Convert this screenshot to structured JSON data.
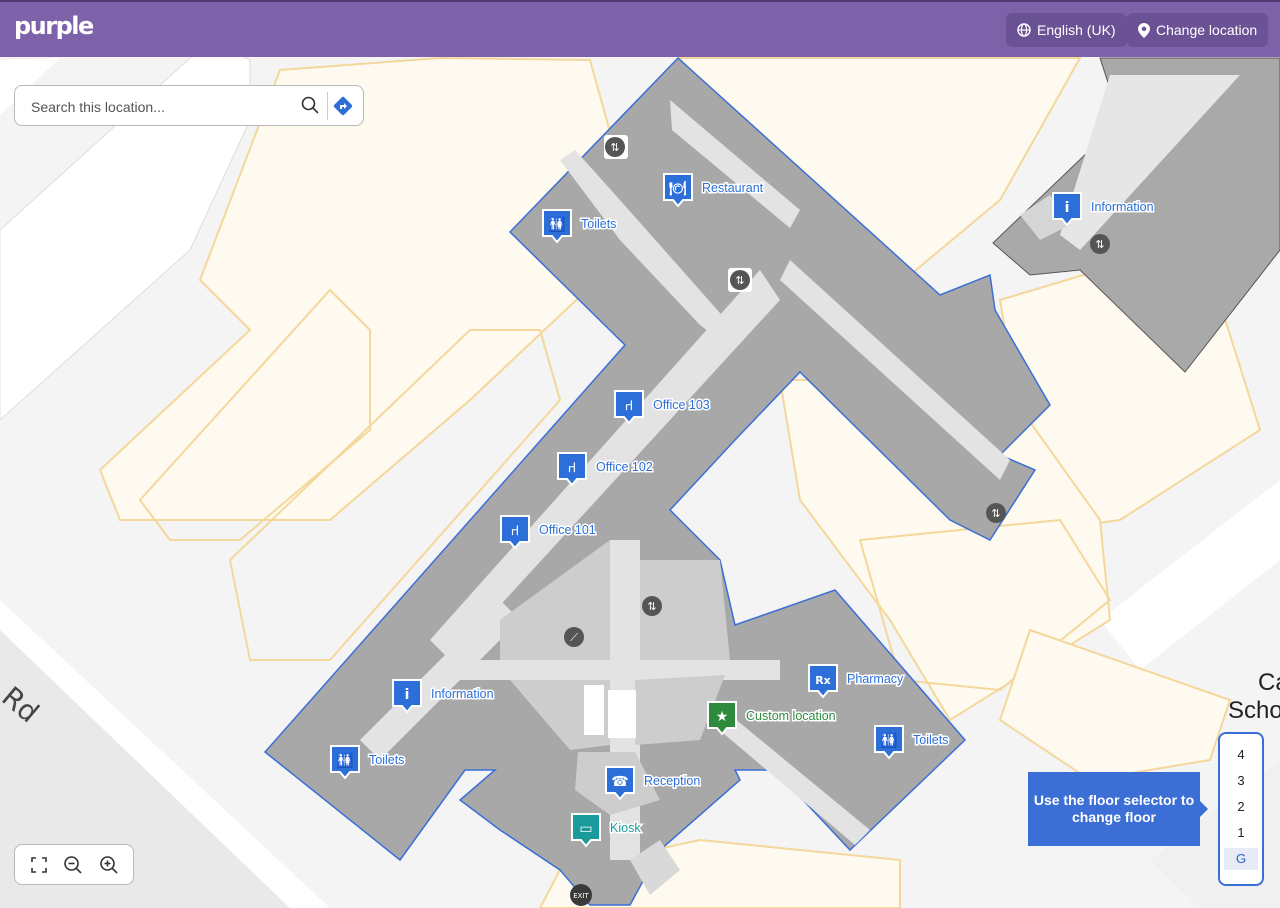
{
  "header": {
    "brand": "purple",
    "language_label": "English (UK)",
    "change_location_label": "Change location",
    "color": "#7d62a9"
  },
  "search": {
    "placeholder": "Search this location...",
    "search_icon": "search-icon",
    "directions_icon": "directions-icon"
  },
  "map": {
    "pois": [
      {
        "label": "Restaurant",
        "icon": "restaurant-icon",
        "color": "#2c6fd8"
      },
      {
        "label": "Toilets",
        "icon": "toilets-icon",
        "color": "#2c6fd8"
      },
      {
        "label": "Information",
        "icon": "information-icon",
        "color": "#2c6fd8"
      },
      {
        "label": "Office 103",
        "icon": "office-chair-icon",
        "color": "#2c6fd8"
      },
      {
        "label": "Office 102",
        "icon": "office-chair-icon",
        "color": "#2c6fd8"
      },
      {
        "label": "Office 101",
        "icon": "office-chair-icon",
        "color": "#2c6fd8"
      },
      {
        "label": "Information",
        "icon": "information-icon",
        "color": "#2c6fd8"
      },
      {
        "label": "Toilets",
        "icon": "toilets-icon",
        "color": "#2c6fd8"
      },
      {
        "label": "Pharmacy",
        "icon": "pharmacy-icon",
        "color": "#2c6fd8"
      },
      {
        "label": "Custom location",
        "icon": "star-icon",
        "color": "#2e8b3d"
      },
      {
        "label": "Toilets",
        "icon": "toilets-icon",
        "color": "#2c6fd8"
      },
      {
        "label": "Reception",
        "icon": "reception-icon",
        "color": "#2c6fd8"
      },
      {
        "label": "Kiosk",
        "icon": "kiosk-icon",
        "color": "#1a9a9a"
      }
    ],
    "street_text": "Rd",
    "building_text": "Ca",
    "building_text_2": "Scho",
    "exit_label": "EXIT"
  },
  "floor_selector": {
    "floors": [
      "4",
      "3",
      "2",
      "1",
      "G"
    ],
    "active": "G",
    "tooltip": "Use the floor selector to change floor"
  },
  "zoom_controls": {
    "icons": [
      "fullscreen-icon",
      "zoom-out-icon",
      "zoom-in-icon"
    ]
  }
}
